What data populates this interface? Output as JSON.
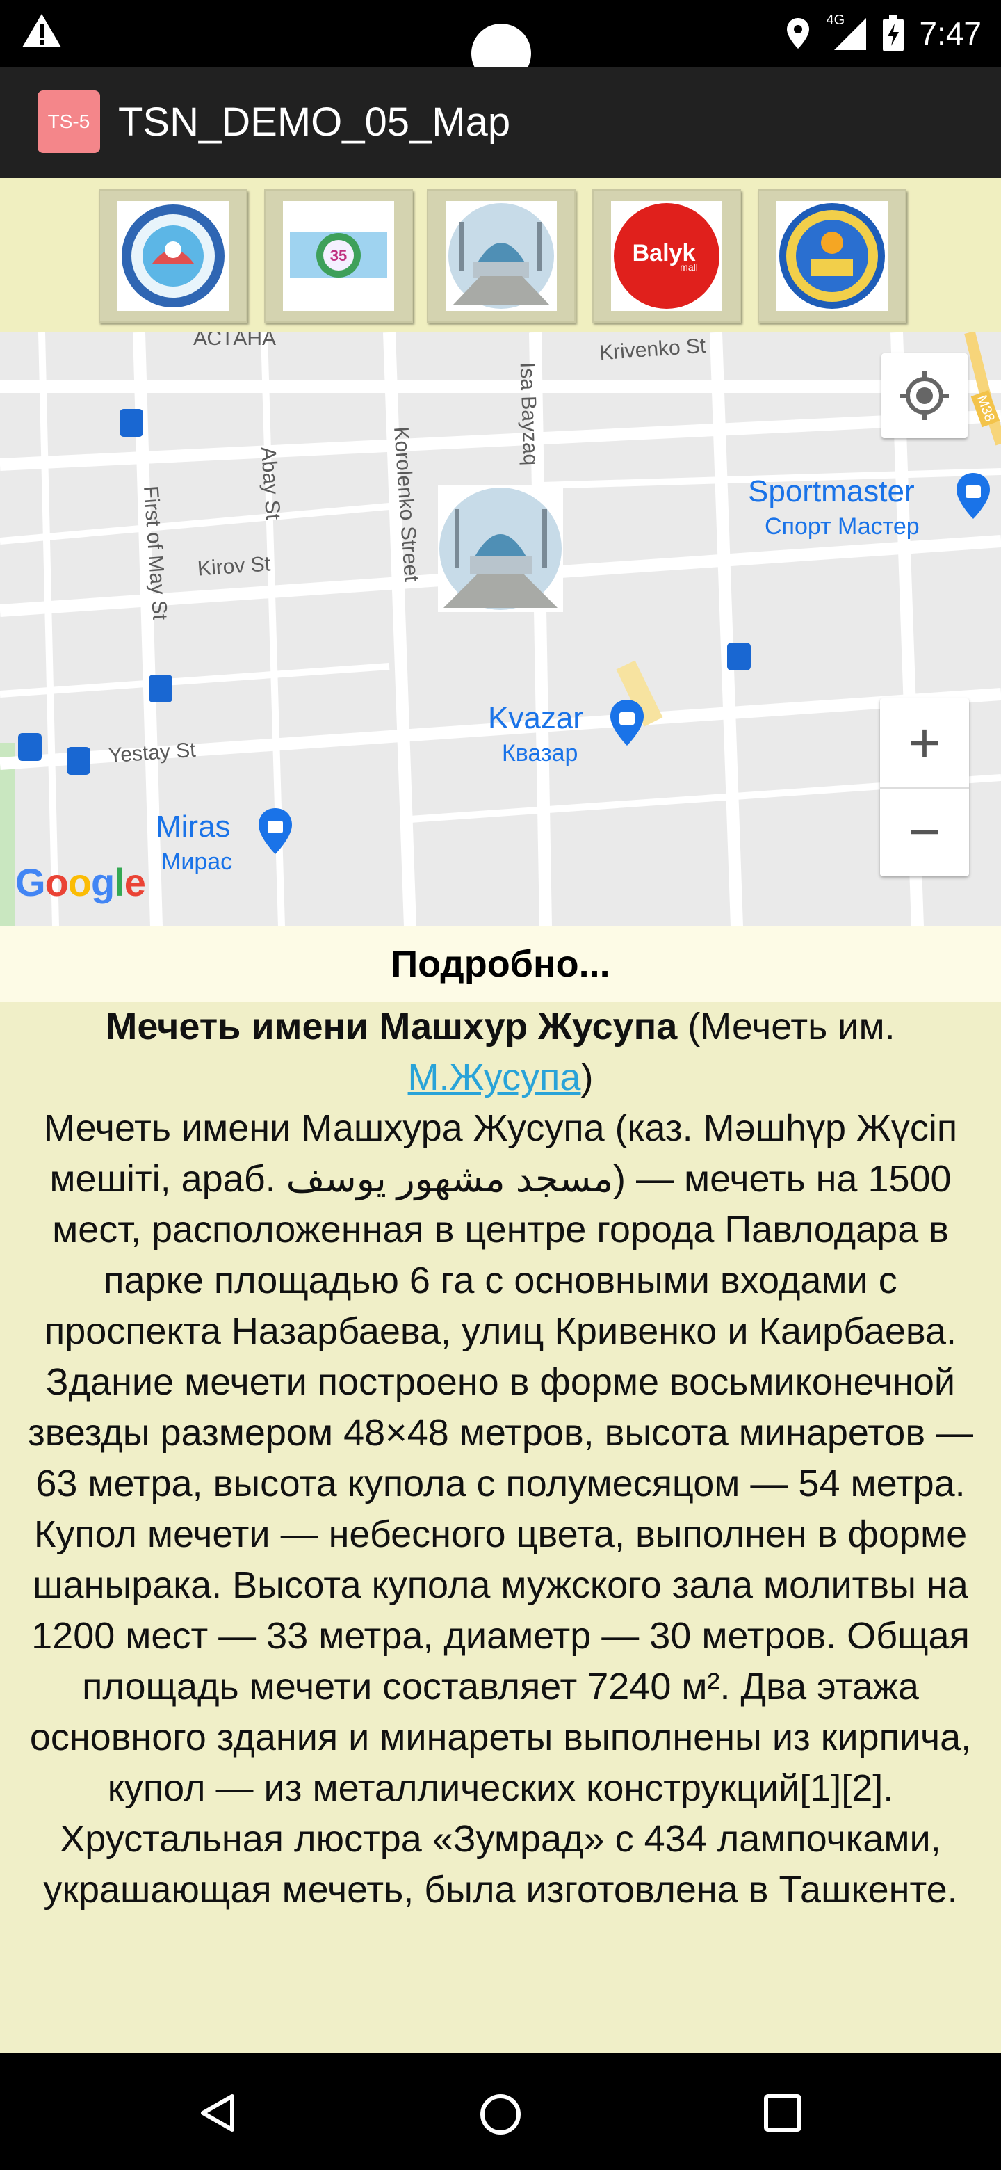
{
  "status_bar": {
    "time": "7:47",
    "network_label": "4G",
    "icons": [
      "warning-icon",
      "location-icon",
      "signal-4g-icon",
      "battery-charging-icon"
    ]
  },
  "app_bar": {
    "icon_text": "TS-5",
    "title": "TSN_DEMO_05_Map"
  },
  "logo_strip": {
    "items": [
      {
        "name": "logo-emblem-blue",
        "icon": "round-emblem-icon"
      },
      {
        "name": "logo-school-35",
        "icon": "badge-35-icon"
      },
      {
        "name": "logo-mosque",
        "icon": "mosque-photo-icon"
      },
      {
        "name": "logo-balyk-mall",
        "icon": "balyk-mall-icon",
        "text": "Balyk mall"
      },
      {
        "name": "logo-emblem-city",
        "icon": "city-emblem-icon"
      }
    ]
  },
  "map": {
    "streets": [
      "АСТАНА",
      "Krivenko St",
      "Isa Bayzaq",
      "Abay St",
      "Korolenko Street",
      "First of May St",
      "Kirov St",
      "Yestay St"
    ],
    "pois": [
      {
        "name": "Sportmaster",
        "sub": "Спорт Мастер"
      },
      {
        "name": "Kvazar",
        "sub": "Квазар"
      },
      {
        "name": "Miras",
        "sub": "Мирас"
      }
    ],
    "route_shield": "M38",
    "zoom_in": "+",
    "zoom_out": "−",
    "attribution": "Google",
    "marker_icon": "mosque-marker-icon",
    "colors": {
      "poi": "#1a73e8",
      "background": "#eaeaea"
    }
  },
  "details_header": "Подробно...",
  "article": {
    "title_bold": "Мечеть имени Машхур Жусупа",
    "title_rest_prefix": " (Мечеть им.",
    "title_link": "М.Жусупа",
    "title_rest_suffix": ")",
    "body": "Мечеть имени Машхура Жусупа (каз. Мәшһүр Жүсіп мешіті, араб. مسجد مشهور يوسف) — мечеть на 1500 мест, расположенная в центре города Павлодара в парке площадью 6 га с основными входами с проспекта Назарбаева, улиц Кривенко и Каирбаева. Здание мечети построено в форме восьмиконечной звезды размером 48×48 метров, высота минаретов — 63 метра, высота купола с полумесяцом — 54 метра. Купол мечети — небесного цвета, выполнен в форме шанырака. Высота купола мужского зала молитвы на 1200 мест — 33 метра, диаметр — 30 метров. Общая площадь мечети составляет 7240 м². Два этажа основного здания и минареты выполнены из кирпича, купол — из металлических конструкций[1][2]. Хрустальная люстра «Зумрад» с 434 лампочками, украшающая мечеть, была изготовлена в Ташкенте."
  },
  "nav_bar": {
    "buttons": [
      "back-icon",
      "home-icon",
      "recents-icon"
    ]
  }
}
